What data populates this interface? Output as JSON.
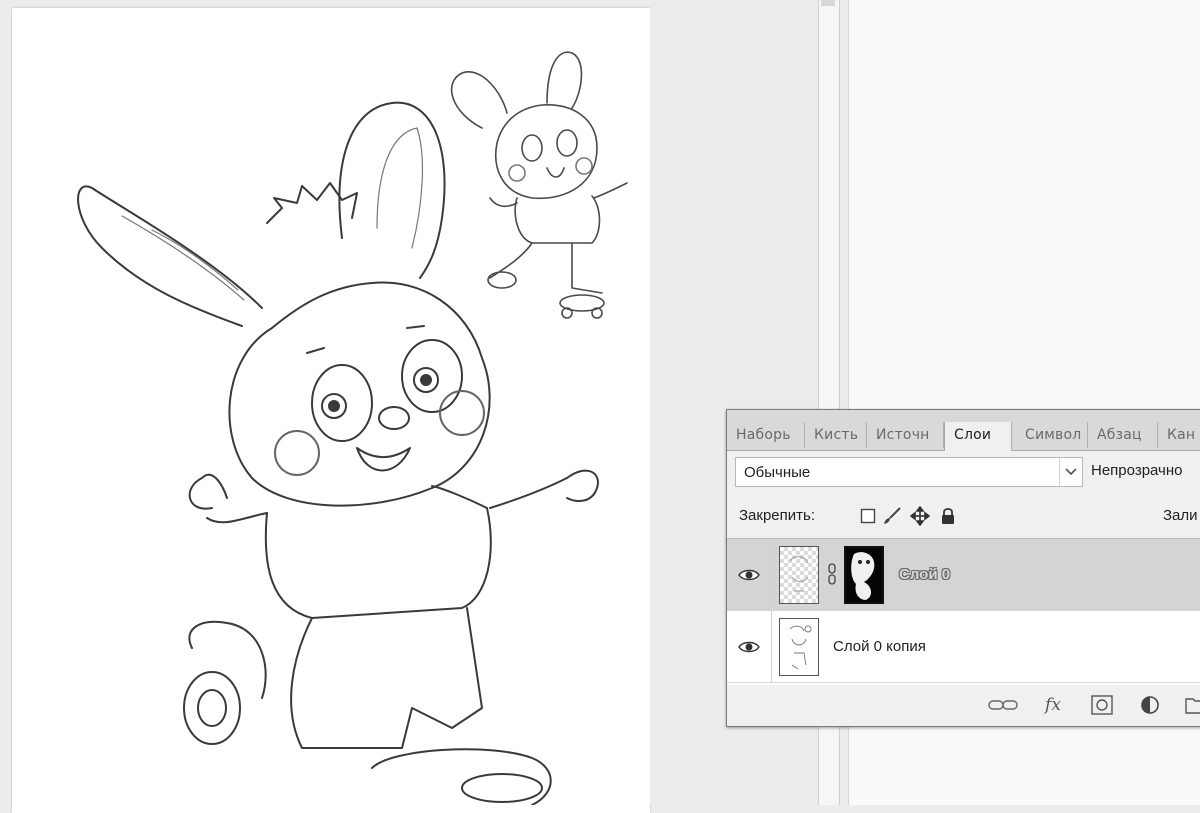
{
  "panel": {
    "tabs": [
      {
        "label": "Наборь",
        "active": false
      },
      {
        "label": "Кисть",
        "active": false
      },
      {
        "label": "Источн",
        "active": false
      },
      {
        "label": "Слои",
        "active": true
      },
      {
        "label": "Символ",
        "active": false
      },
      {
        "label": "Абзац",
        "active": false
      },
      {
        "label": "Кан",
        "active": false
      }
    ],
    "blend_mode": "Обычные",
    "opacity_label": "Непрозрачно",
    "lock_label": "Закрепить:",
    "fill_label": "Зали",
    "lock_icons": [
      "lock-transparency-icon",
      "lock-brush-icon",
      "lock-move-icon",
      "lock-all-icon"
    ],
    "layers": [
      {
        "name": "Слой 0",
        "visible": true,
        "selected": true,
        "has_mask": true,
        "icon": "eye-icon"
      },
      {
        "name": "Слой 0 копия",
        "visible": true,
        "selected": false,
        "has_mask": false,
        "icon": "eye-icon"
      }
    ],
    "footer_icons": [
      "link-layers-icon",
      "fx-icon",
      "add-mask-icon",
      "adjustment-layer-icon",
      "new-group-icon"
    ],
    "footer_fx_label": "fx"
  },
  "canvas": {
    "content": "coloring-page-bunnies-on-roller-skates"
  }
}
